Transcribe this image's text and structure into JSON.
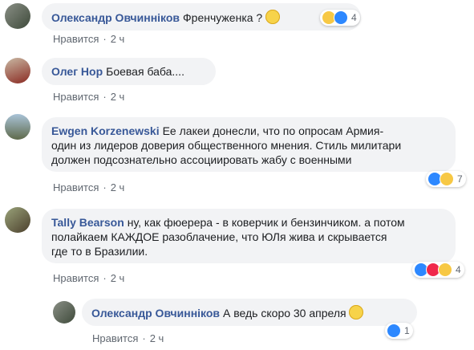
{
  "like_label": "Нравится",
  "comments": [
    {
      "author": "Олександр Овчинніков",
      "text": "Френчуженка ?",
      "time": "2 ч",
      "reaction_count": "4",
      "reactions": [
        "haha-icon",
        "like-icon"
      ]
    },
    {
      "author": "Олег Нор",
      "text": "Боевая баба....",
      "time": "2 ч"
    },
    {
      "author": "Ewgen Korzenewski",
      "text_lines": [
        "Ее лакеи донесли, что по опросам Армия-",
        "один из лидеров доверия общественного мнения. Стиль милитари",
        "должен подсознательно ассоциировать жабу с военными"
      ],
      "time": "2 ч",
      "reaction_count": "7",
      "reactions": [
        "like-icon",
        "haha-icon"
      ]
    },
    {
      "author": "Tally Bearson",
      "text_lines": [
        "ну, как фюерера - в коверчик и бензинчиком. а потом",
        "полайкаем КАЖДОЕ разоблачение, что ЮЛя жива и скрывается",
        "где то в Бразилии."
      ],
      "time": "2 ч",
      "reaction_count": "4",
      "reactions": [
        "like-icon",
        "love-icon",
        "haha-icon"
      ]
    },
    {
      "author": "Олександр Овчинніков",
      "text": "А ведь скоро 30 апреля",
      "time": "2 ч",
      "reaction_count": "1",
      "reactions": [
        "like-icon"
      ]
    }
  ]
}
